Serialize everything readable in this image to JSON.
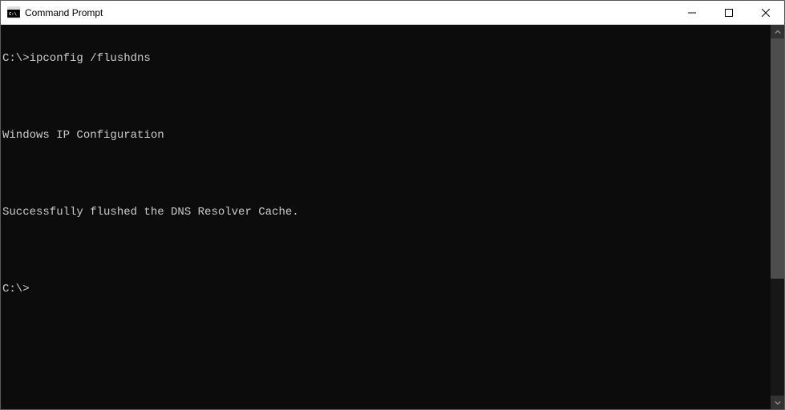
{
  "window": {
    "title": "Command Prompt"
  },
  "terminal": {
    "lines": [
      "C:\\>ipconfig /flushdns",
      "",
      "Windows IP Configuration",
      "",
      "Successfully flushed the DNS Resolver Cache.",
      "",
      "C:\\>"
    ]
  }
}
